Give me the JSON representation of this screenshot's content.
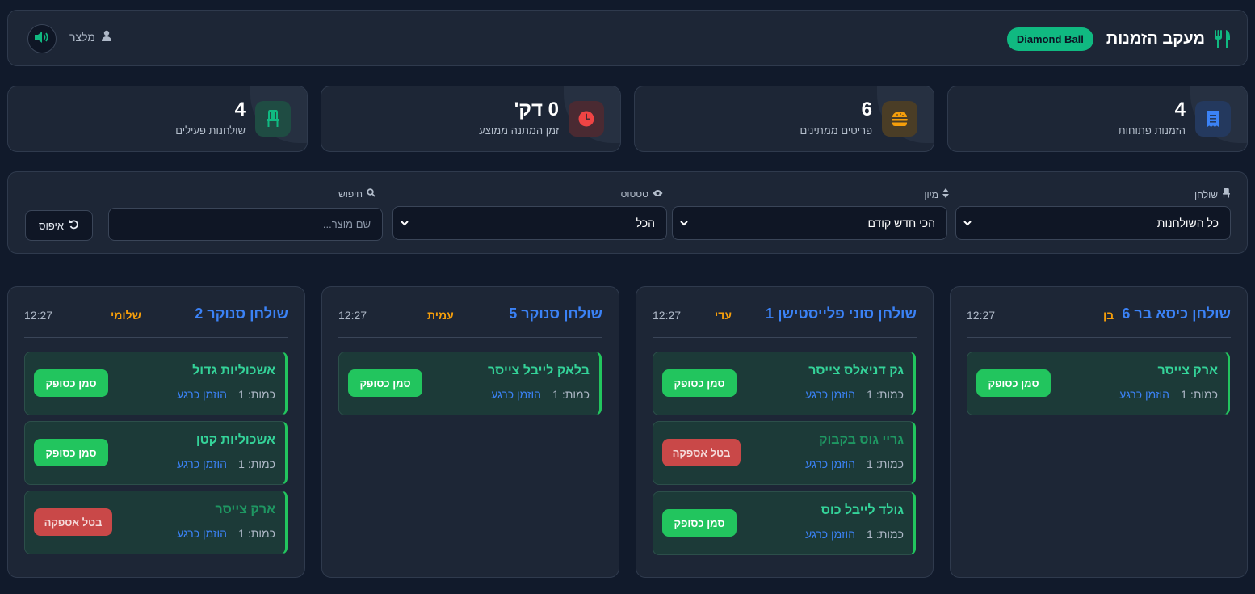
{
  "header": {
    "title": "מעקב הזמנות",
    "badge": "Diamond Ball",
    "user": "מלצר",
    "brand_icon": "utensils-icon",
    "accent": "#10b981"
  },
  "stats": [
    {
      "value": "4",
      "label": "הזמנות פתוחות",
      "icon": "receipt-icon",
      "color": "#3b82f6"
    },
    {
      "value": "6",
      "label": "פריטים ממתינים",
      "icon": "burger-icon",
      "color": "#f59e0b"
    },
    {
      "value": "0 דק'",
      "label": "זמן המתנה ממוצע",
      "icon": "clock-icon",
      "color": "#ef4444"
    },
    {
      "value": "4",
      "label": "שולחנות פעילים",
      "icon": "chair-icon",
      "color": "#10b981"
    }
  ],
  "filters": {
    "table_label": "שולחן",
    "table_value": "כל השולחנות",
    "sort_label": "מיון",
    "sort_value": "הכי חדש קודם",
    "status_label": "סטטוס",
    "status_value": "הכל",
    "search_label": "חיפוש",
    "search_placeholder": "שם מוצר...",
    "reset_label": "איפוס"
  },
  "tables": [
    {
      "name": "שולחן כיסא בר 6",
      "waiter": "בן",
      "time": "12:27",
      "items": [
        {
          "name": "ארק צייסר",
          "qty": "כמות: 1",
          "link": "הוזמן כרגע",
          "action": "סמן כסופק",
          "status": "pending"
        }
      ]
    },
    {
      "name": "שולחן סוני פלייסטישן 1",
      "waiter": "עדי",
      "time": "12:27",
      "items": [
        {
          "name": "גק דניאלס צייסר",
          "qty": "כמות: 1",
          "link": "הוזמן כרגע",
          "action": "סמן כסופק",
          "status": "pending"
        },
        {
          "name": "גריי גוס בקבוק",
          "qty": "כמות: 1",
          "link": "הוזמן כרגע",
          "action": "בטל אספקה",
          "status": "delivered"
        },
        {
          "name": "גולד לייבל כוס",
          "qty": "כמות: 1",
          "link": "הוזמן כרגע",
          "action": "סמן כסופק",
          "status": "pending"
        }
      ]
    },
    {
      "name": "שולחן סנוקר 5",
      "waiter": "עמית",
      "time": "12:27",
      "items": [
        {
          "name": "בלאק לייבל צייסר",
          "qty": "כמות: 1",
          "link": "הוזמן כרגע",
          "action": "סמן כסופק",
          "status": "pending"
        }
      ]
    },
    {
      "name": "שולחן סנוקר 2",
      "waiter": "שלומי",
      "time": "12:27",
      "items": [
        {
          "name": "אשכוליות גדול",
          "qty": "כמות: 1",
          "link": "הוזמן כרגע",
          "action": "סמן כסופק",
          "status": "pending"
        },
        {
          "name": "אשכוליות קטן",
          "qty": "כמות: 1",
          "link": "הוזמן כרגע",
          "action": "סמן כסופק",
          "status": "pending"
        },
        {
          "name": "ארק צייסר",
          "qty": "כמות: 1",
          "link": "הוזמן כרגע",
          "action": "בטל אספקה",
          "status": "delivered"
        }
      ]
    }
  ]
}
